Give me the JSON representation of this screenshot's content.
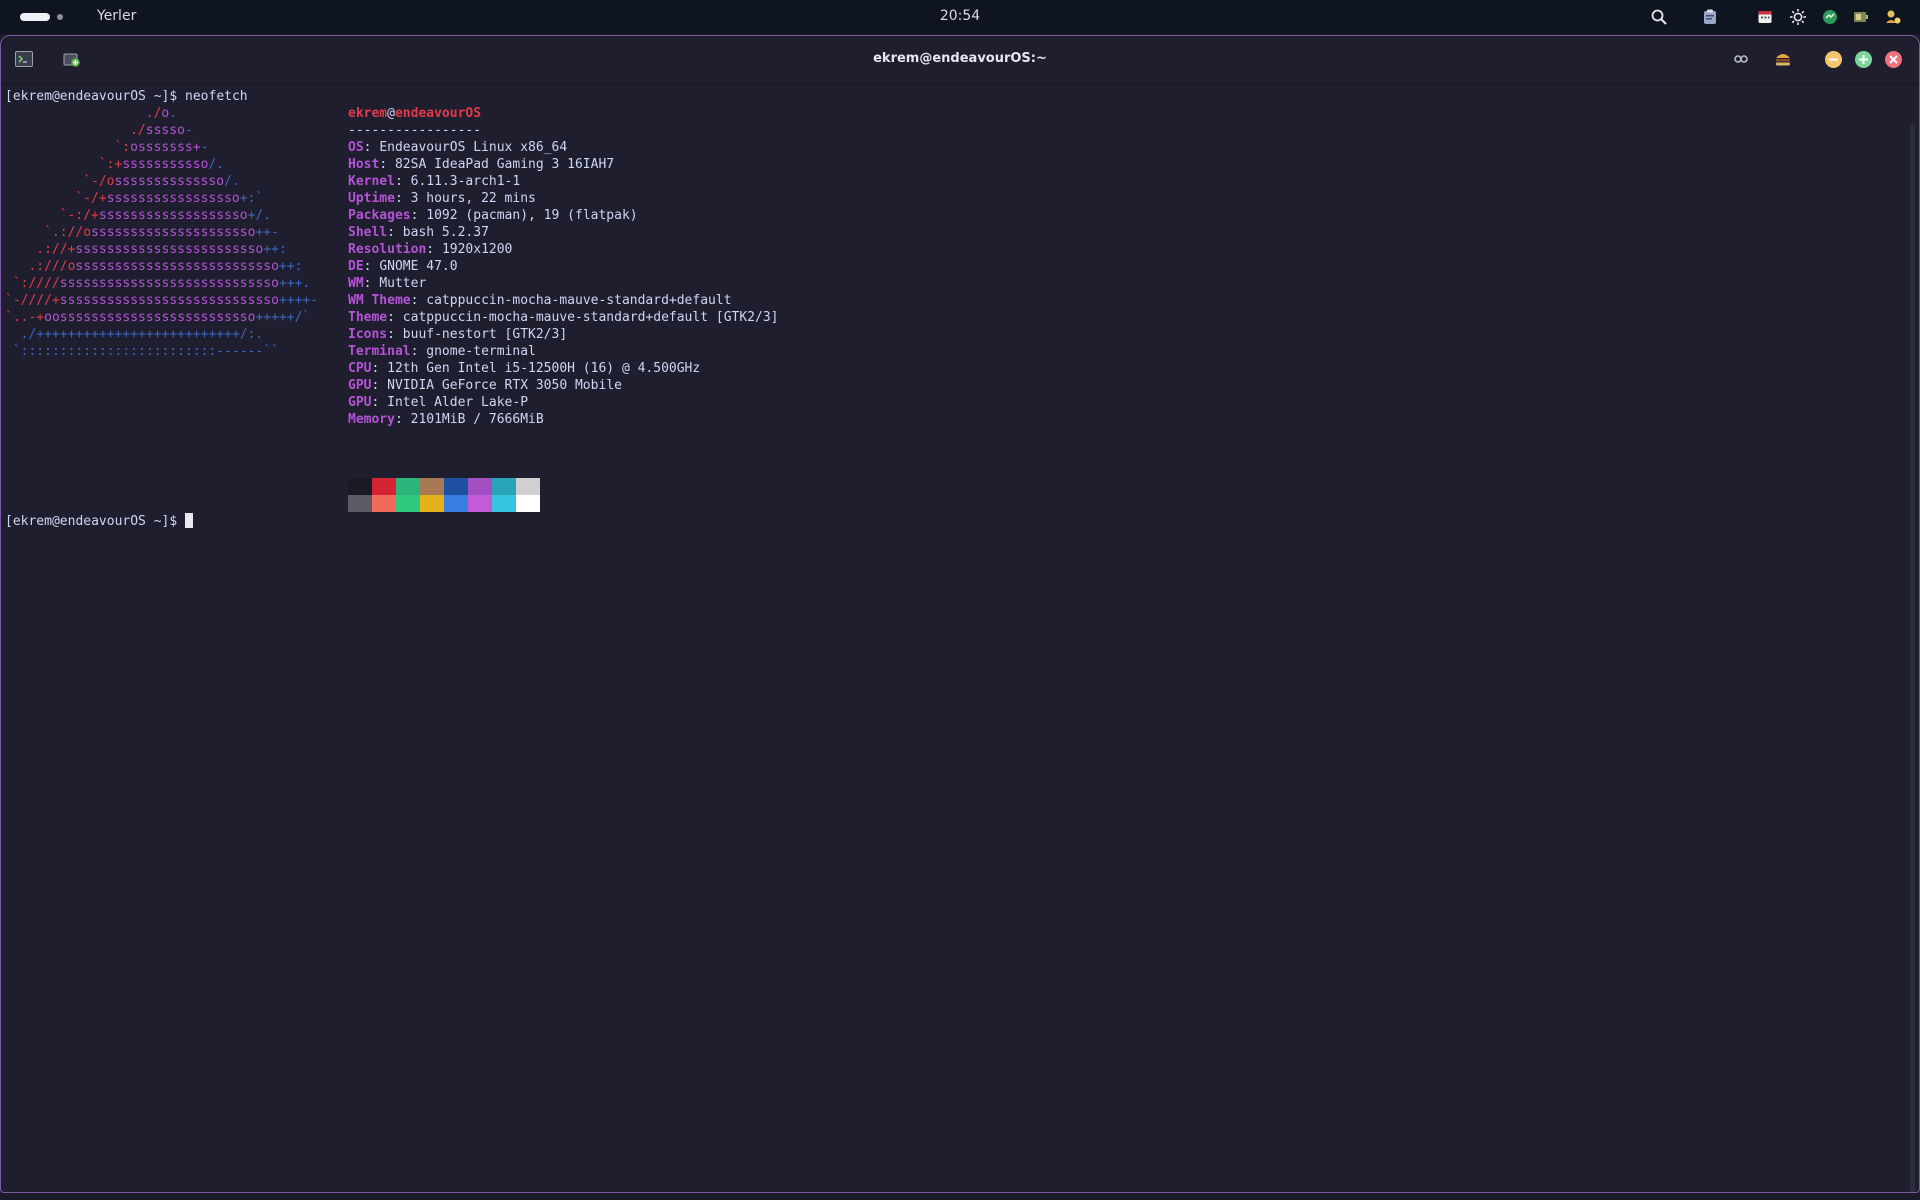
{
  "topbar": {
    "places_label": "Yerler",
    "clock": "20:54",
    "tray_icons": [
      "search-icon",
      "clipboard-icon",
      "calendar-icon",
      "brightness-icon",
      "extension-icon",
      "battery-icon",
      "user-status-icon"
    ]
  },
  "window": {
    "title": "ekrem@endeavourOS:~",
    "left_buttons": [
      "terminal-icon",
      "new-tab-icon"
    ],
    "right_buttons": [
      "search-icon",
      "menu-icon"
    ],
    "controls": [
      "minimize",
      "maximize",
      "close"
    ]
  },
  "terminal": {
    "prompt1": "[ekrem@endeavourOS ~]$ ",
    "command1": "neofetch",
    "prompt2": "[ekrem@endeavourOS ~]$ ",
    "logo": [
      [
        [
          "r",
          "./"
        ],
        [
          "p",
          "o"
        ],
        [
          "b",
          "."
        ]
      ],
      [
        [
          "r",
          "./"
        ],
        [
          "p",
          "sssso"
        ],
        [
          "b",
          "-"
        ]
      ],
      [
        [
          "r",
          "`:"
        ],
        [
          "p",
          "osssssss+"
        ],
        [
          "b",
          "-"
        ]
      ],
      [
        [
          "r",
          "`:+"
        ],
        [
          "p",
          "sssssssssso"
        ],
        [
          "b",
          "/."
        ]
      ],
      [
        [
          "r",
          "`-/o"
        ],
        [
          "p",
          "ssssssssssssso"
        ],
        [
          "b",
          "/."
        ]
      ],
      [
        [
          "r",
          "`-/+"
        ],
        [
          "p",
          "sssssssssssssssso"
        ],
        [
          "b",
          "+:`"
        ]
      ],
      [
        [
          "r",
          "`-:/+"
        ],
        [
          "p",
          "sssssssssssssssssso"
        ],
        [
          "b",
          "+/."
        ]
      ],
      [
        [
          "r",
          "`.://o"
        ],
        [
          "p",
          "sssssssssssssssssssso"
        ],
        [
          "b",
          "++-"
        ]
      ],
      [
        [
          "r",
          ".://+"
        ],
        [
          "p",
          "ssssssssssssssssssssssso"
        ],
        [
          "b",
          "++:"
        ]
      ],
      [
        [
          "r",
          ".:///o"
        ],
        [
          "p",
          "ssssssssssssssssssssssssso"
        ],
        [
          "b",
          "++:"
        ]
      ],
      [
        [
          "r",
          "`:////"
        ],
        [
          "p",
          "ssssssssssssssssssssssssssso"
        ],
        [
          "b",
          "+++."
        ]
      ],
      [
        [
          "r",
          "`-////+"
        ],
        [
          "p",
          "ssssssssssssssssssssssssssso"
        ],
        [
          "b",
          "++++-"
        ]
      ],
      [
        [
          "r",
          "`..-+"
        ],
        [
          "p",
          "oosssssssssssssssssssssssso"
        ],
        [
          "b",
          "+++++/`"
        ]
      ],
      [
        [
          "b",
          "./++++++++++++++++++++++++++/:."
        ]
      ],
      [
        [
          "b",
          "`:::::::::::::::::::::::::------``"
        ]
      ]
    ],
    "logo_indents": [
      18,
      16,
      14,
      12,
      10,
      9,
      7,
      5,
      4,
      3,
      1,
      0,
      0,
      2,
      1
    ],
    "user": "ekrem",
    "at": "@",
    "hostname": "endeavourOS",
    "separator": "-----------------",
    "info": [
      {
        "label": "OS",
        "value": "EndeavourOS Linux x86_64"
      },
      {
        "label": "Host",
        "value": "82SA IdeaPad Gaming 3 16IAH7"
      },
      {
        "label": "Kernel",
        "value": "6.11.3-arch1-1"
      },
      {
        "label": "Uptime",
        "value": "3 hours, 22 mins"
      },
      {
        "label": "Packages",
        "value": "1092 (pacman), 19 (flatpak)"
      },
      {
        "label": "Shell",
        "value": "bash 5.2.37"
      },
      {
        "label": "Resolution",
        "value": "1920x1200"
      },
      {
        "label": "DE",
        "value": "GNOME 47.0"
      },
      {
        "label": "WM",
        "value": "Mutter"
      },
      {
        "label": "WM Theme",
        "value": "catppuccin-mocha-mauve-standard+default"
      },
      {
        "label": "Theme",
        "value": "catppuccin-mocha-mauve-standard+default [GTK2/3]"
      },
      {
        "label": "Icons",
        "value": "buuf-nestort [GTK2/3]"
      },
      {
        "label": "Terminal",
        "value": "gnome-terminal"
      },
      {
        "label": "CPU",
        "value": "12th Gen Intel i5-12500H (16) @ 4.500GHz"
      },
      {
        "label": "GPU",
        "value": "NVIDIA GeForce RTX 3050 Mobile"
      },
      {
        "label": "GPU",
        "value": "Intel Alder Lake-P"
      },
      {
        "label": "Memory",
        "value": "2101MiB / 7666MiB"
      }
    ],
    "palette_top": [
      "#1a1a25",
      "#d32334",
      "#2bb57a",
      "#a77a55",
      "#1e4fa0",
      "#a24fc4",
      "#2aa5b7",
      "#d0d0d4"
    ],
    "palette_bottom": [
      "#5b5b66",
      "#f06a5a",
      "#2fc87f",
      "#e6b21c",
      "#3a7de3",
      "#c55ad8",
      "#36c6e0",
      "#ffffff"
    ]
  }
}
